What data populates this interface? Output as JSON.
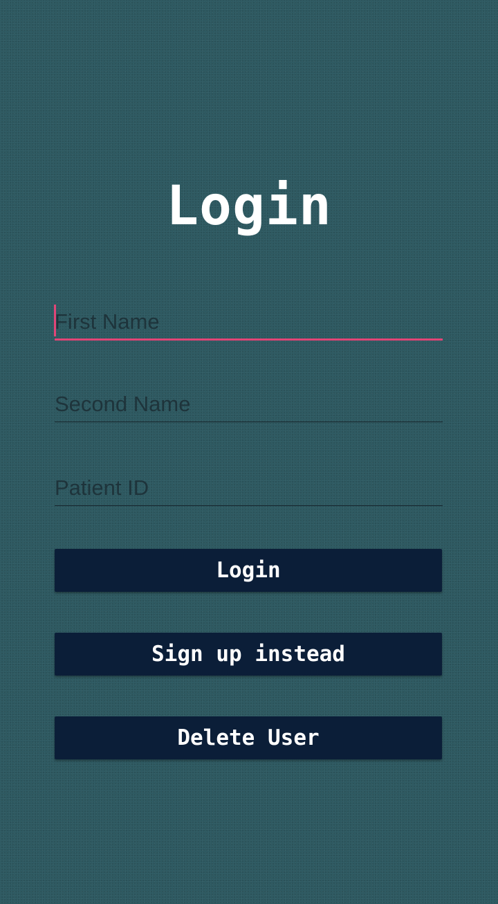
{
  "screen": {
    "title": "Login"
  },
  "form": {
    "first_name_placeholder": "First Name",
    "second_name_placeholder": "Second Name",
    "patient_id_placeholder": "Patient ID"
  },
  "buttons": {
    "login_label": "Login",
    "signup_label": "Sign up instead",
    "delete_label": "Delete User"
  },
  "colors": {
    "background": "#2c5860",
    "accent": "#e24577",
    "button": "#0b1e38"
  }
}
